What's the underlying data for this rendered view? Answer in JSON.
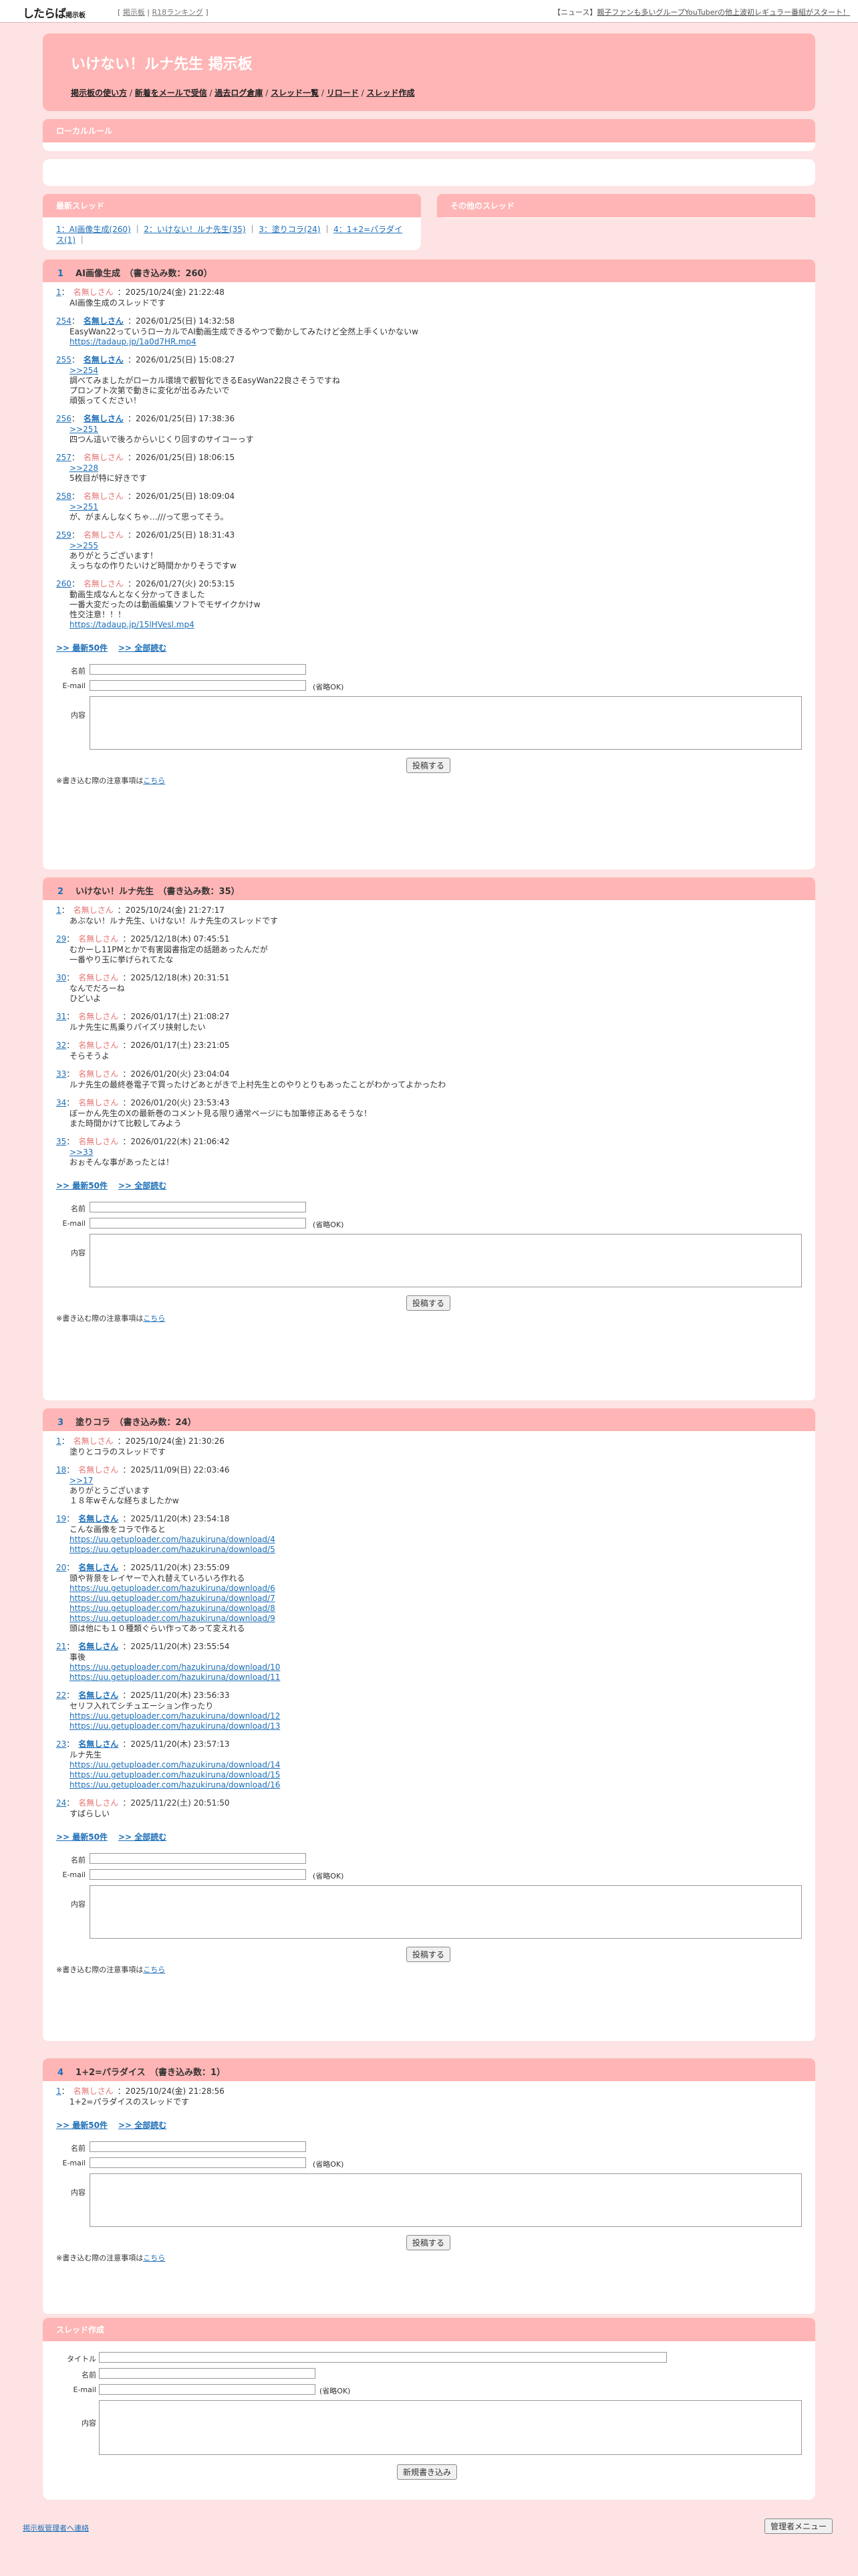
{
  "topbar": {
    "logo": "したらば",
    "logo_small": "掲示板",
    "links": [
      "[",
      "掲示板",
      "|",
      "R18ランキング",
      "]"
    ],
    "news_prefix": "【ニュース】",
    "news": "親子ファンも多いグループYouTuberの他上波初レギュラー番組がスタート！"
  },
  "header": {
    "title": "いけない！ルナ先生 掲示板",
    "nav": [
      "掲示板の使い方",
      "新着をメールで受信",
      "過去ログ倉庫",
      "スレッド一覧",
      "リロード",
      "スレッド作成"
    ]
  },
  "local_rule": {
    "title": "ローカルルール"
  },
  "recent": {
    "title": "最新スレッド",
    "items": [
      "1：AI画像生成(260)",
      "2：いけない！ルナ先生(35)",
      "3：塗りコラ(24)",
      "4：1+2=パラダイス(1)"
    ]
  },
  "other": {
    "title": "その他のスレッド"
  },
  "form_labels": {
    "name": "名前",
    "email": "E-mail",
    "content": "内容",
    "optional": "(省略OK)",
    "submit": "投稿する",
    "note_prefix": "※書き込む際の注意事項は",
    "note_link": "こちら",
    "more_latest": ">> 最新50件",
    "more_all": ">> 全部読む"
  },
  "threads": [
    {
      "num": "1",
      "title": "AI画像生成　（書き込み数：260）",
      "posts": [
        {
          "n": "1",
          "name": "名無しさん",
          "b": false,
          "date": "：2025/10/24(金) 21:22:48",
          "lines": [
            "AI画像生成のスレッドです"
          ]
        },
        {
          "n": "254",
          "name": "名無しさん",
          "b": true,
          "date": "：2026/01/25(日) 14:32:58",
          "lines": [
            "EasyWan22っていうローカルでAI動画生成できるやつで動かしてみたけど全然上手くいかないw",
            "~https://tadaup.jp/1a0d7HR.mp4"
          ]
        },
        {
          "n": "255",
          "name": "名無しさん",
          "b": true,
          "date": "：2026/01/25(日) 15:08:27",
          "lines": [
            "~>>254",
            "調べてみましたがローカル環境で叡智化できるEasyWan22良さそうですね",
            "プロンプト次第で動きに変化が出るみたいで",
            "頑張ってください！"
          ]
        },
        {
          "n": "256",
          "name": "名無しさん",
          "b": true,
          "date": "：2026/01/25(日) 17:38:36",
          "lines": [
            "~>>251",
            "四つん這いで後ろからいじくり回すのサイコーっす"
          ]
        },
        {
          "n": "257",
          "name": "名無しさん",
          "b": false,
          "date": "：2026/01/25(日) 18:06:15",
          "lines": [
            "~>>228",
            "5枚目が特に好きです"
          ]
        },
        {
          "n": "258",
          "name": "名無しさん",
          "b": false,
          "date": "：2026/01/25(日) 18:09:04",
          "lines": [
            "~>>251",
            "が、がまんしなくちゃ…///って思ってそう。"
          ]
        },
        {
          "n": "259",
          "name": "名無しさん",
          "b": false,
          "date": "：2026/01/25(日) 18:31:43",
          "lines": [
            "~>>255",
            "ありがとうございます！",
            "えっちなの作りたいけど時間かかりそうですw"
          ]
        },
        {
          "n": "260",
          "name": "名無しさん",
          "b": false,
          "date": "：2026/01/27(火) 20:53:15",
          "lines": [
            "動画生成なんとなく分かってきました",
            "一番大変だったのは動画編集ソフトでモザイクかけw",
            "性交注意！！！",
            "~https://tadaup.jp/15lHVesl.mp4"
          ]
        }
      ]
    },
    {
      "num": "2",
      "title": "いけない！ルナ先生　（書き込み数：35）",
      "posts": [
        {
          "n": "1",
          "name": "名無しさん",
          "b": false,
          "date": "：2025/10/24(金) 21:27:17",
          "lines": [
            "あぶない！ルナ先生、いけない！ルナ先生のスレッドです"
          ]
        },
        {
          "n": "29",
          "name": "名無しさん",
          "b": false,
          "date": "：2025/12/18(木) 07:45:51",
          "lines": [
            "むかーし11PMとかで有害図書指定の話題あったんだが",
            "一番やり玉に挙げられてたな"
          ]
        },
        {
          "n": "30",
          "name": "名無しさん",
          "b": false,
          "date": "：2025/12/18(木) 20:31:51",
          "lines": [
            "なんでだろーね",
            "ひどいよ"
          ]
        },
        {
          "n": "31",
          "name": "名無しさん",
          "b": false,
          "date": "：2026/01/17(土) 21:08:27",
          "lines": [
            "ルナ先生に馬乗りパイズリ挟射したい"
          ]
        },
        {
          "n": "32",
          "name": "名無しさん",
          "b": false,
          "date": "：2026/01/17(土) 23:21:05",
          "lines": [
            "そらそうよ"
          ]
        },
        {
          "n": "33",
          "name": "名無しさん",
          "b": false,
          "date": "：2026/01/20(火) 23:04:04",
          "lines": [
            "ルナ先生の最終巻電子で買ったけどあとがきで上村先生とのやりとりもあったことがわかってよかったわ"
          ]
        },
        {
          "n": "34",
          "name": "名無しさん",
          "b": false,
          "date": "：2026/01/20(火) 23:53:43",
          "lines": [
            "ぼーかん先生のXの最新巻のコメント見る限り通常ページにも加筆修正あるそうな！",
            "また時間かけて比較してみよう"
          ]
        },
        {
          "n": "35",
          "name": "名無しさん",
          "b": false,
          "date": "：2026/01/22(木) 21:06:42",
          "lines": [
            "~>>33",
            "おぉそんな事があったとは！"
          ]
        }
      ]
    },
    {
      "num": "3",
      "title": "塗りコラ　（書き込み数：24）",
      "posts": [
        {
          "n": "1",
          "name": "名無しさん",
          "b": false,
          "date": "：2025/10/24(金) 21:30:26",
          "lines": [
            "塗りとコラのスレッドです"
          ]
        },
        {
          "n": "18",
          "name": "名無しさん",
          "b": false,
          "date": "：2025/11/09(日) 22:03:46",
          "lines": [
            "~>>17",
            "ありがとうございます",
            "１８年wそんな経ちましたかw"
          ]
        },
        {
          "n": "19",
          "name": "名無しさん",
          "b": true,
          "date": "：2025/11/20(木) 23:54:18",
          "lines": [
            "こんな画像をコラで作ると",
            "~https://uu.getuploader.com/hazukiruna/download/4",
            "~https://uu.getuploader.com/hazukiruna/download/5"
          ]
        },
        {
          "n": "20",
          "name": "名無しさん",
          "b": true,
          "date": "：2025/11/20(木) 23:55:09",
          "lines": [
            "頭や背景をレイヤーで入れ替えていろいろ作れる",
            "~https://uu.getuploader.com/hazukiruna/download/6",
            "~https://uu.getuploader.com/hazukiruna/download/7",
            "~https://uu.getuploader.com/hazukiruna/download/8",
            "~https://uu.getuploader.com/hazukiruna/download/9",
            "頭は他にも１０種類ぐらい作ってあって変えれる"
          ]
        },
        {
          "n": "21",
          "name": "名無しさん",
          "b": true,
          "date": "：2025/11/20(木) 23:55:54",
          "lines": [
            "事後",
            "~https://uu.getuploader.com/hazukiruna/download/10",
            "~https://uu.getuploader.com/hazukiruna/download/11"
          ]
        },
        {
          "n": "22",
          "name": "名無しさん",
          "b": true,
          "date": "：2025/11/20(木) 23:56:33",
          "lines": [
            "セリフ入れてシチュエーション作ったり",
            "~https://uu.getuploader.com/hazukiruna/download/12",
            "~https://uu.getuploader.com/hazukiruna/download/13"
          ]
        },
        {
          "n": "23",
          "name": "名無しさん",
          "b": true,
          "date": "：2025/11/20(木) 23:57:13",
          "lines": [
            "ルナ先生",
            "~https://uu.getuploader.com/hazukiruna/download/14",
            "~https://uu.getuploader.com/hazukiruna/download/15",
            "~https://uu.getuploader.com/hazukiruna/download/16"
          ]
        },
        {
          "n": "24",
          "name": "名無しさん",
          "b": false,
          "date": "：2025/11/22(土) 20:51:50",
          "lines": [
            "すばらしい"
          ]
        }
      ]
    },
    {
      "num": "4",
      "title": "1+2=パラダイス　（書き込み数：1）",
      "posts": [
        {
          "n": "1",
          "name": "名無しさん",
          "b": false,
          "date": "：2025/10/24(金) 21:28:56",
          "lines": [
            "1+2=パラダイスのスレッドです"
          ]
        }
      ]
    }
  ],
  "create": {
    "title": "スレッド作成",
    "label_title": "タイトル",
    "label_name": "名前",
    "label_email": "E-mail",
    "label_content": "内容",
    "optional": "(省略OK)",
    "submit": "新規書き込み"
  },
  "footer": {
    "contact": "掲示板管理者へ連絡",
    "admin": "管理者メニュー"
  }
}
